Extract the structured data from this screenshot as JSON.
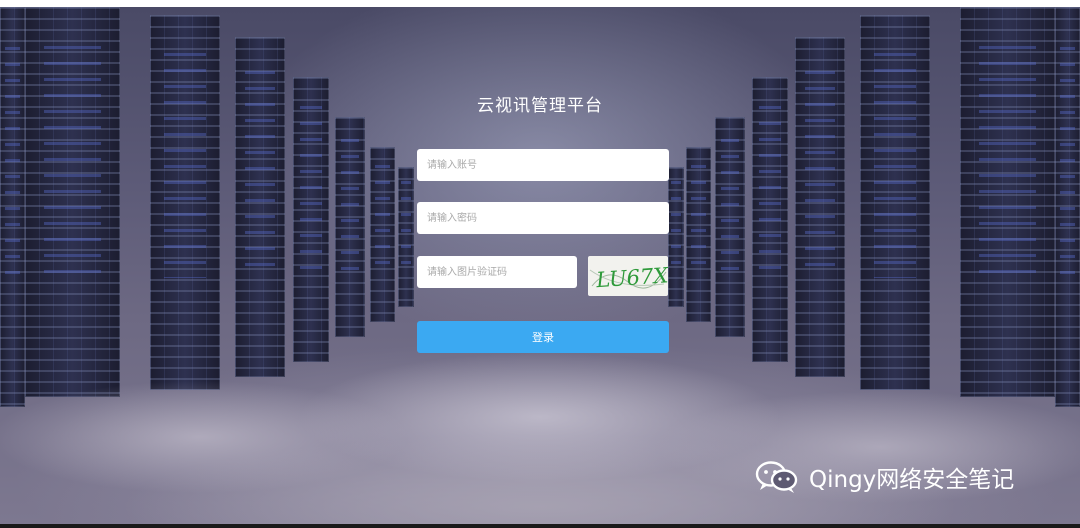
{
  "page": {
    "title": "云视讯管理平台"
  },
  "form": {
    "account_placeholder": "请输入账号",
    "password_placeholder": "请输入密码",
    "captcha_placeholder": "请输入图片验证码",
    "captcha_text": "LU67X",
    "login_label": "登录"
  },
  "watermark": {
    "text": "Qingy网络安全笔记",
    "icon": "wechat-icon"
  },
  "colors": {
    "login_button": "#3ba9f2",
    "captcha_ink": "#2e9a3a",
    "background": "#5d5b78"
  }
}
